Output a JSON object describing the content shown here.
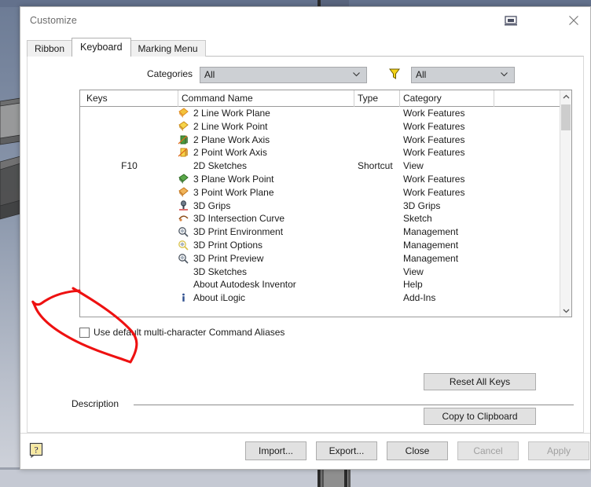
{
  "window": {
    "title": "Customize",
    "dock_icon": "dock-icon",
    "close_icon": "close-icon"
  },
  "tabs": [
    {
      "label": "Ribbon",
      "active": false
    },
    {
      "label": "Keyboard",
      "active": true
    },
    {
      "label": "Marking Menu",
      "active": false
    }
  ],
  "filters": {
    "categories_label": "Categories",
    "categories_value": "All",
    "filter_icon": "funnel-filter-icon",
    "type_value": "All"
  },
  "list": {
    "columns": [
      "Keys",
      "Command Name",
      "Type",
      "Category"
    ],
    "rows": [
      {
        "keys": "",
        "icon": "2-line-work-plane-icon",
        "command": "2 Line Work Plane",
        "type": "",
        "category": "Work Features"
      },
      {
        "keys": "",
        "icon": "2-line-work-point-icon",
        "command": "2 Line Work Point",
        "type": "",
        "category": "Work Features"
      },
      {
        "keys": "",
        "icon": "2-plane-work-axis-icon",
        "command": "2 Plane Work Axis",
        "type": "",
        "category": "Work Features"
      },
      {
        "keys": "",
        "icon": "2-point-work-axis-icon",
        "command": "2 Point Work Axis",
        "type": "",
        "category": "Work Features"
      },
      {
        "keys": "F10",
        "icon": "",
        "command": "2D Sketches",
        "type": "Shortcut",
        "category": "View"
      },
      {
        "keys": "",
        "icon": "3-plane-work-point-icon",
        "command": "3 Plane Work Point",
        "type": "",
        "category": "Work Features"
      },
      {
        "keys": "",
        "icon": "3-point-work-plane-icon",
        "command": "3 Point Work Plane",
        "type": "",
        "category": "Work Features"
      },
      {
        "keys": "",
        "icon": "3d-grips-icon",
        "command": "3D Grips",
        "type": "",
        "category": "3D Grips"
      },
      {
        "keys": "",
        "icon": "3d-intersection-curve-icon",
        "command": "3D Intersection Curve",
        "type": "",
        "category": "Sketch"
      },
      {
        "keys": "",
        "icon": "3d-print-environment-icon",
        "command": "3D Print Environment",
        "type": "",
        "category": "Management"
      },
      {
        "keys": "",
        "icon": "3d-print-options-icon",
        "command": "3D Print Options",
        "type": "",
        "category": "Management"
      },
      {
        "keys": "",
        "icon": "3d-print-preview-icon",
        "command": "3D Print Preview",
        "type": "",
        "category": "Management"
      },
      {
        "keys": "",
        "icon": "",
        "command": "3D Sketches",
        "type": "",
        "category": "View"
      },
      {
        "keys": "",
        "icon": "",
        "command": "About Autodesk Inventor",
        "type": "",
        "category": "Help"
      },
      {
        "keys": "",
        "icon": "about-ilogic-info-icon",
        "command": "About iLogic",
        "type": "",
        "category": "Add-Ins"
      }
    ],
    "scrollbar": {
      "up_icon": "chevron-up-icon",
      "down_icon": "chevron-down-icon"
    }
  },
  "options": {
    "use_default_aliases_label": "Use default multi-character Command Aliases",
    "use_default_aliases_checked": false
  },
  "actions": {
    "reset_all_keys": "Reset All Keys",
    "copy_to_clipboard": "Copy to Clipboard",
    "description_label": "Description",
    "description_value": ""
  },
  "footer": {
    "help_icon": "help-question-icon",
    "import": "Import...",
    "export": "Export...",
    "close": "Close",
    "cancel": "Cancel",
    "apply": "Apply",
    "cancel_disabled": true,
    "apply_disabled": true
  },
  "annotation": {
    "color": "#ee1111",
    "shape": "hand-drawn-loop"
  },
  "colors": {
    "dialog_bg": "#ffffff",
    "combo_bg": "#cdd0d4",
    "button_bg": "#e1e1e1",
    "disabled_text": "#a0a0a0",
    "annotation_red": "#ee1111",
    "viewport_top": "#7f8ca4",
    "viewport_bottom": "#c8ccd6"
  }
}
